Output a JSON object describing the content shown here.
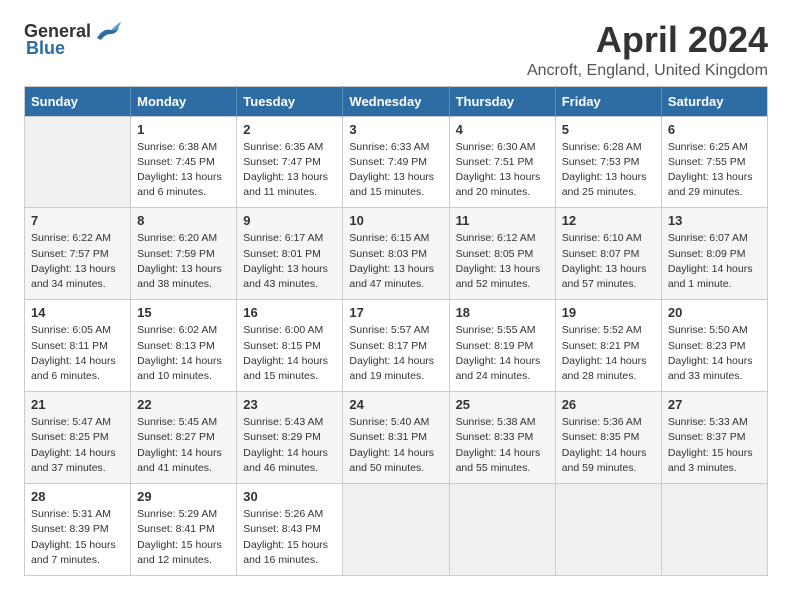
{
  "header": {
    "logo_general": "General",
    "logo_blue": "Blue",
    "title": "April 2024",
    "subtitle": "Ancroft, England, United Kingdom"
  },
  "calendar": {
    "days_of_week": [
      "Sunday",
      "Monday",
      "Tuesday",
      "Wednesday",
      "Thursday",
      "Friday",
      "Saturday"
    ],
    "weeks": [
      [
        {
          "day": "",
          "info": ""
        },
        {
          "day": "1",
          "info": "Sunrise: 6:38 AM\nSunset: 7:45 PM\nDaylight: 13 hours\nand 6 minutes."
        },
        {
          "day": "2",
          "info": "Sunrise: 6:35 AM\nSunset: 7:47 PM\nDaylight: 13 hours\nand 11 minutes."
        },
        {
          "day": "3",
          "info": "Sunrise: 6:33 AM\nSunset: 7:49 PM\nDaylight: 13 hours\nand 15 minutes."
        },
        {
          "day": "4",
          "info": "Sunrise: 6:30 AM\nSunset: 7:51 PM\nDaylight: 13 hours\nand 20 minutes."
        },
        {
          "day": "5",
          "info": "Sunrise: 6:28 AM\nSunset: 7:53 PM\nDaylight: 13 hours\nand 25 minutes."
        },
        {
          "day": "6",
          "info": "Sunrise: 6:25 AM\nSunset: 7:55 PM\nDaylight: 13 hours\nand 29 minutes."
        }
      ],
      [
        {
          "day": "7",
          "info": "Sunrise: 6:22 AM\nSunset: 7:57 PM\nDaylight: 13 hours\nand 34 minutes."
        },
        {
          "day": "8",
          "info": "Sunrise: 6:20 AM\nSunset: 7:59 PM\nDaylight: 13 hours\nand 38 minutes."
        },
        {
          "day": "9",
          "info": "Sunrise: 6:17 AM\nSunset: 8:01 PM\nDaylight: 13 hours\nand 43 minutes."
        },
        {
          "day": "10",
          "info": "Sunrise: 6:15 AM\nSunset: 8:03 PM\nDaylight: 13 hours\nand 47 minutes."
        },
        {
          "day": "11",
          "info": "Sunrise: 6:12 AM\nSunset: 8:05 PM\nDaylight: 13 hours\nand 52 minutes."
        },
        {
          "day": "12",
          "info": "Sunrise: 6:10 AM\nSunset: 8:07 PM\nDaylight: 13 hours\nand 57 minutes."
        },
        {
          "day": "13",
          "info": "Sunrise: 6:07 AM\nSunset: 8:09 PM\nDaylight: 14 hours\nand 1 minute."
        }
      ],
      [
        {
          "day": "14",
          "info": "Sunrise: 6:05 AM\nSunset: 8:11 PM\nDaylight: 14 hours\nand 6 minutes."
        },
        {
          "day": "15",
          "info": "Sunrise: 6:02 AM\nSunset: 8:13 PM\nDaylight: 14 hours\nand 10 minutes."
        },
        {
          "day": "16",
          "info": "Sunrise: 6:00 AM\nSunset: 8:15 PM\nDaylight: 14 hours\nand 15 minutes."
        },
        {
          "day": "17",
          "info": "Sunrise: 5:57 AM\nSunset: 8:17 PM\nDaylight: 14 hours\nand 19 minutes."
        },
        {
          "day": "18",
          "info": "Sunrise: 5:55 AM\nSunset: 8:19 PM\nDaylight: 14 hours\nand 24 minutes."
        },
        {
          "day": "19",
          "info": "Sunrise: 5:52 AM\nSunset: 8:21 PM\nDaylight: 14 hours\nand 28 minutes."
        },
        {
          "day": "20",
          "info": "Sunrise: 5:50 AM\nSunset: 8:23 PM\nDaylight: 14 hours\nand 33 minutes."
        }
      ],
      [
        {
          "day": "21",
          "info": "Sunrise: 5:47 AM\nSunset: 8:25 PM\nDaylight: 14 hours\nand 37 minutes."
        },
        {
          "day": "22",
          "info": "Sunrise: 5:45 AM\nSunset: 8:27 PM\nDaylight: 14 hours\nand 41 minutes."
        },
        {
          "day": "23",
          "info": "Sunrise: 5:43 AM\nSunset: 8:29 PM\nDaylight: 14 hours\nand 46 minutes."
        },
        {
          "day": "24",
          "info": "Sunrise: 5:40 AM\nSunset: 8:31 PM\nDaylight: 14 hours\nand 50 minutes."
        },
        {
          "day": "25",
          "info": "Sunrise: 5:38 AM\nSunset: 8:33 PM\nDaylight: 14 hours\nand 55 minutes."
        },
        {
          "day": "26",
          "info": "Sunrise: 5:36 AM\nSunset: 8:35 PM\nDaylight: 14 hours\nand 59 minutes."
        },
        {
          "day": "27",
          "info": "Sunrise: 5:33 AM\nSunset: 8:37 PM\nDaylight: 15 hours\nand 3 minutes."
        }
      ],
      [
        {
          "day": "28",
          "info": "Sunrise: 5:31 AM\nSunset: 8:39 PM\nDaylight: 15 hours\nand 7 minutes."
        },
        {
          "day": "29",
          "info": "Sunrise: 5:29 AM\nSunset: 8:41 PM\nDaylight: 15 hours\nand 12 minutes."
        },
        {
          "day": "30",
          "info": "Sunrise: 5:26 AM\nSunset: 8:43 PM\nDaylight: 15 hours\nand 16 minutes."
        },
        {
          "day": "",
          "info": ""
        },
        {
          "day": "",
          "info": ""
        },
        {
          "day": "",
          "info": ""
        },
        {
          "day": "",
          "info": ""
        }
      ]
    ]
  }
}
